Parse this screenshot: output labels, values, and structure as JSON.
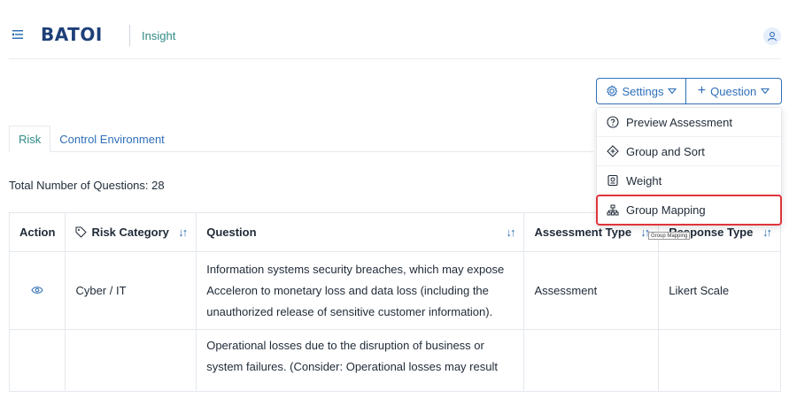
{
  "header": {
    "logo_text": "BATOI",
    "app_name": "Insight"
  },
  "toolbar": {
    "settings_label": "Settings",
    "question_label": "Question"
  },
  "tabs": [
    {
      "label": "Risk",
      "active": true
    },
    {
      "label": "Control Environment",
      "active": false
    }
  ],
  "summary": {
    "total_questions": "Total Number of Questions: 28"
  },
  "table": {
    "headers": {
      "action": "Action",
      "risk_category": "Risk Category",
      "question": "Question",
      "assessment_type": "Assessment Type",
      "response_type": "Response Type"
    },
    "rows": [
      {
        "risk_category": "Cyber / IT",
        "question": "Information systems security breaches, which may expose Acceleron to monetary loss and data loss (including the unauthorized release of sensitive customer information).",
        "assessment_type": "Assessment",
        "response_type": "Likert Scale"
      },
      {
        "risk_category": "",
        "question": "Operational losses due to the disruption of business or system failures. (Consider: Operational losses may result",
        "assessment_type": "",
        "response_type": ""
      }
    ]
  },
  "settings_menu": {
    "items": [
      {
        "label": "Preview Assessment",
        "icon": "question-circle-icon"
      },
      {
        "label": "Group and Sort",
        "icon": "diamond-arrows-icon"
      },
      {
        "label": "Weight",
        "icon": "weight-icon"
      },
      {
        "label": "Group Mapping",
        "icon": "hierarchy-icon"
      }
    ]
  },
  "tooltip": {
    "text": "Group Mapping"
  },
  "colors": {
    "primary": "#2f6fb8",
    "teal": "#2f8a86",
    "highlight": "#e0343b"
  }
}
